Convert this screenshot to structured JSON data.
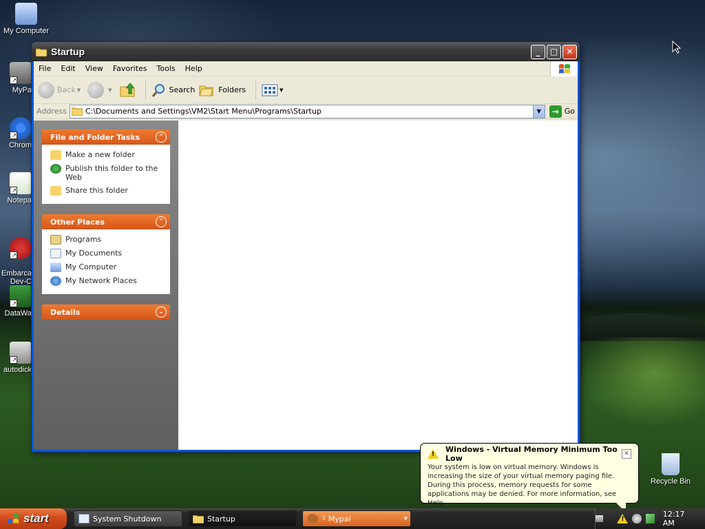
{
  "desktop": {
    "icons": [
      {
        "label": "My Computer",
        "icon": "my-computer-icon"
      },
      {
        "label": "MyPa",
        "icon": "mypal-icon"
      },
      {
        "label": "Chrom",
        "icon": "chrome-icon"
      },
      {
        "label": "Notepa",
        "icon": "notepad-icon"
      },
      {
        "label": "Embarca\nDev-C",
        "icon": "devcpp-icon"
      },
      {
        "label": "DataWa",
        "icon": "datawa-icon"
      },
      {
        "label": "autodick",
        "icon": "autoclicker-icon"
      }
    ],
    "recycle_bin": {
      "label": "Recycle Bin",
      "icon": "recycle-bin-icon"
    }
  },
  "window": {
    "title": "Startup",
    "menu": [
      "File",
      "Edit",
      "View",
      "Favorites",
      "Tools",
      "Help"
    ],
    "toolbar": {
      "back": "Back",
      "search": "Search",
      "folders": "Folders"
    },
    "address": {
      "label": "Address",
      "path": "C:\\Documents and Settings\\VM2\\Start Menu\\Programs\\Startup",
      "go": "Go"
    },
    "tasks": {
      "file_folder_tasks": {
        "title": "File and Folder Tasks",
        "items": [
          "Make a new folder",
          "Publish this folder to the Web",
          "Share this folder"
        ]
      },
      "other_places": {
        "title": "Other Places",
        "items": [
          "Programs",
          "My Documents",
          "My Computer",
          "My Network Places"
        ]
      },
      "details": {
        "title": "Details"
      }
    }
  },
  "balloon": {
    "title": "Windows - Virtual Memory Minimum Too Low",
    "text": "Your system is low on virtual memory. Windows is increasing the size of your virtual memory paging file. During this process, memory requests for some applications may be denied. For more information, see Help."
  },
  "taskbar": {
    "start": "start",
    "buttons": [
      "System Shutdown",
      "Startup",
      "Mypal"
    ],
    "mypal_count": "3",
    "clock": "12:17 AM"
  }
}
